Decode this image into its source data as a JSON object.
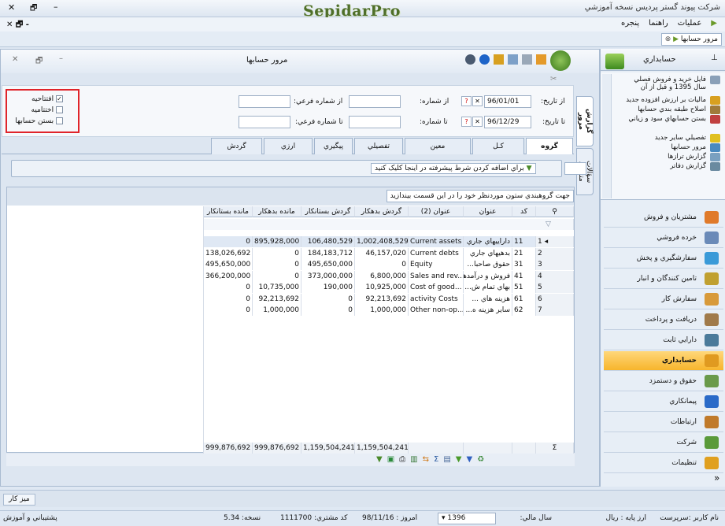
{
  "titlebar": {
    "app_title": "شرکت پیوند گستر پردیس نسخه آموزشي",
    "logo": "SepidarPro",
    "controls": {
      "close": "✕",
      "restore": "🗗",
      "minimize": "–"
    },
    "mdi_controls": "✕ 🗗 -"
  },
  "menu": {
    "items": [
      "عمليات",
      "راهنما",
      "پنجره"
    ]
  },
  "doc_tab": {
    "label": "مرور حسابها"
  },
  "inner_window": {
    "title": "مرور حسابها",
    "controls": [
      "✕",
      "🗗",
      "–"
    ]
  },
  "filters": {
    "from_date_label": "از تاريخ:",
    "from_date": "96/01/01",
    "to_date_label": "تا تاريخ:",
    "to_date": "96/12/29",
    "from_number_label": "از شماره:",
    "to_number_label": "تا شماره:",
    "from_sub_label": "از شماره فرعي:",
    "to_sub_label": "تا شماره فرعي:",
    "checks": [
      {
        "label": "افتتاحيه",
        "checked": true
      },
      {
        "label": "اختتاميه",
        "checked": false
      },
      {
        "label": "بستن حسابها",
        "checked": false
      }
    ],
    "highlight_color": "#e0242a"
  },
  "side_tabs": [
    "گزارش مرور",
    "سؤالات متداول"
  ],
  "tabs": [
    "گروه",
    "کـل",
    "معين",
    "تفصيلي",
    "پيگيري",
    "ارزي",
    "گردش"
  ],
  "condition_bar": {
    "text": "براي اضافه کردن شرط پيشرفته در اينجا کليک کنيد"
  },
  "grid": {
    "group_hint": "جهت گروهبندي ستون موردنظر خود را در اين قسمت بيندازيد",
    "columns": [
      "کد",
      "عنوان",
      "عنوان (2)",
      "گردش بدهکار",
      "گردش بستانکار",
      "مانده بدهکار",
      "مانده بستانکار"
    ],
    "rows": [
      {
        "n": "1",
        "code": "11",
        "title": "داراييهاي جاري",
        "title2": "Current assets",
        "dr_turn": "1,002,408,529",
        "cr_turn": "106,480,529",
        "dr_bal": "895,928,000",
        "cr_bal": "0"
      },
      {
        "n": "2",
        "code": "21",
        "title": "بدهيهاي جاري",
        "title2": "Current debts",
        "dr_turn": "46,157,020",
        "cr_turn": "184,183,712",
        "dr_bal": "0",
        "cr_bal": "138,026,692"
      },
      {
        "n": "3",
        "code": "31",
        "title": "حقوق صاحبا...",
        "title2": "Equity",
        "dr_turn": "0",
        "cr_turn": "495,650,000",
        "dr_bal": "0",
        "cr_bal": "495,650,000"
      },
      {
        "n": "4",
        "code": "41",
        "title": "فروش و درآمدها",
        "title2": "Sales and rev...",
        "dr_turn": "6,800,000",
        "cr_turn": "373,000,000",
        "dr_bal": "0",
        "cr_bal": "366,200,000"
      },
      {
        "n": "5",
        "code": "51",
        "title": "بهاي تمام ش...",
        "title2": "Cost of good...",
        "dr_turn": "10,925,000",
        "cr_turn": "190,000",
        "dr_bal": "10,735,000",
        "cr_bal": "0"
      },
      {
        "n": "6",
        "code": "61",
        "title": "هزينه هاي ...",
        "title2": "activity Costs",
        "dr_turn": "92,213,692",
        "cr_turn": "0",
        "dr_bal": "92,213,692",
        "cr_bal": "0"
      },
      {
        "n": "7",
        "code": "62",
        "title": "ساير هزينه ه...",
        "title2": "Other non-op...",
        "dr_turn": "1,000,000",
        "cr_turn": "0",
        "dr_bal": "1,000,000",
        "cr_bal": "0"
      }
    ],
    "totals": {
      "dr_turn": "1,159,504,241",
      "cr_turn": "1,159,504,241",
      "dr_bal": "999,876,692",
      "cr_bal": "999,876,692"
    },
    "sigma": "Σ"
  },
  "right_pane": {
    "title": "حسابداري",
    "pin": "⊥",
    "list": [
      "فايل خريد و فروش فصلي سال 1395 و قبل از آن",
      "ماليات بر ارزش افزوده جديد",
      "اصلاح طبقه بندي حسابها",
      "بستن حسابهاي سود و زياني",
      "تفصيلي ساير جديد",
      "مرور حسابها",
      "گزارش ترازها",
      "گزارش دفاتر"
    ],
    "nav": [
      "مشتريان و فروش",
      "خرده فروشي",
      "سفارشگيري و پخش",
      "تامين کنندگان و انبار",
      "سفارش کار",
      "دريافت و پرداخت",
      "دارايي ثابت",
      "حسابداري",
      "حقوق و دستمزد",
      "پيمانکاري",
      "ارتباطات",
      "شرکت",
      "تنظيمات"
    ],
    "active_nav": "حسابداري",
    "more": "»"
  },
  "desk": {
    "label": "ميز کار"
  },
  "status": {
    "user": "نام کاربر :سرپرست",
    "currency": "ارز پايه : ريال",
    "fiscal_label": "سال مالي:",
    "fiscal_year": "1396",
    "today": "امروز : 98/11/16",
    "customer_code": "کد مشتري: 1111700",
    "version": "نسخه: 5.34",
    "support": "پشتيباني و آموزش"
  },
  "colors": {
    "accent": "#f7b52c",
    "window_bg": "#dde6f1",
    "brand": "#4f6f2a"
  }
}
